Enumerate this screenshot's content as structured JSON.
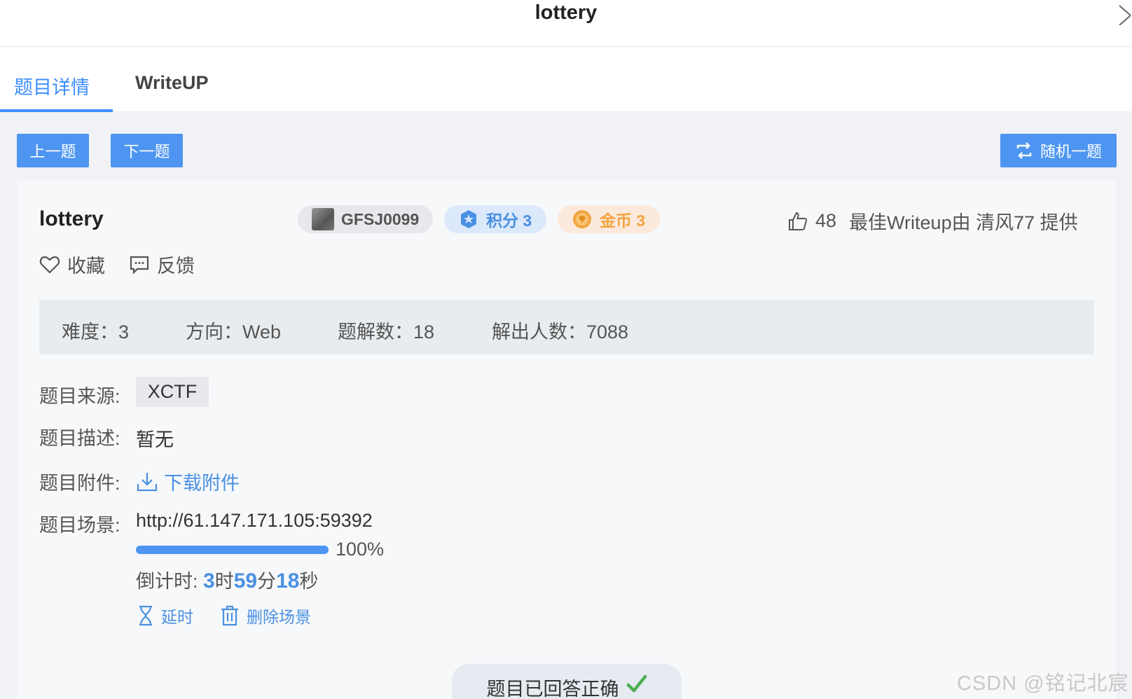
{
  "modal": {
    "title": "lottery"
  },
  "tabs": [
    {
      "label": "题目详情",
      "active": true
    },
    {
      "label": "WriteUP",
      "active": false
    }
  ],
  "nav": {
    "prev": "上一题",
    "next": "下一题",
    "random": "随机一题"
  },
  "challenge": {
    "title": "lottery",
    "code": "GFSJ0099",
    "score": "积分 3",
    "gold": "金币 3",
    "likes": "48",
    "best_writeup": "最佳Writeup由 清风77 提供",
    "favorite": "收藏",
    "feedback": "反馈"
  },
  "stats": {
    "difficulty": "难度：3",
    "direction": "方向：Web",
    "solutions": "题解数：18",
    "solvers": "解出人数：7088"
  },
  "fields": {
    "source_label": "题目来源:",
    "source_value": "XCTF",
    "desc_label": "题目描述:",
    "desc_value": "暂无",
    "attach_label": "题目附件:",
    "attach_value": "下载附件",
    "scene_label": "题目场景:",
    "scene_url": "http://61.147.171.105:59392"
  },
  "progress": {
    "value": 100,
    "text": "100%"
  },
  "countdown": {
    "label": "倒计时: ",
    "hours": "3",
    "hours_unit": "时",
    "minutes": "59",
    "minutes_unit": "分",
    "seconds": "18",
    "seconds_unit": "秒"
  },
  "scene_actions": {
    "extend": "延时",
    "delete": "删除场景"
  },
  "status": {
    "solved": "题目已回答正确"
  },
  "watermark": "CSDN @铭记北宸",
  "colors": {
    "accent": "#4d95f0",
    "gold": "#f2a540",
    "success": "#4caf50"
  }
}
